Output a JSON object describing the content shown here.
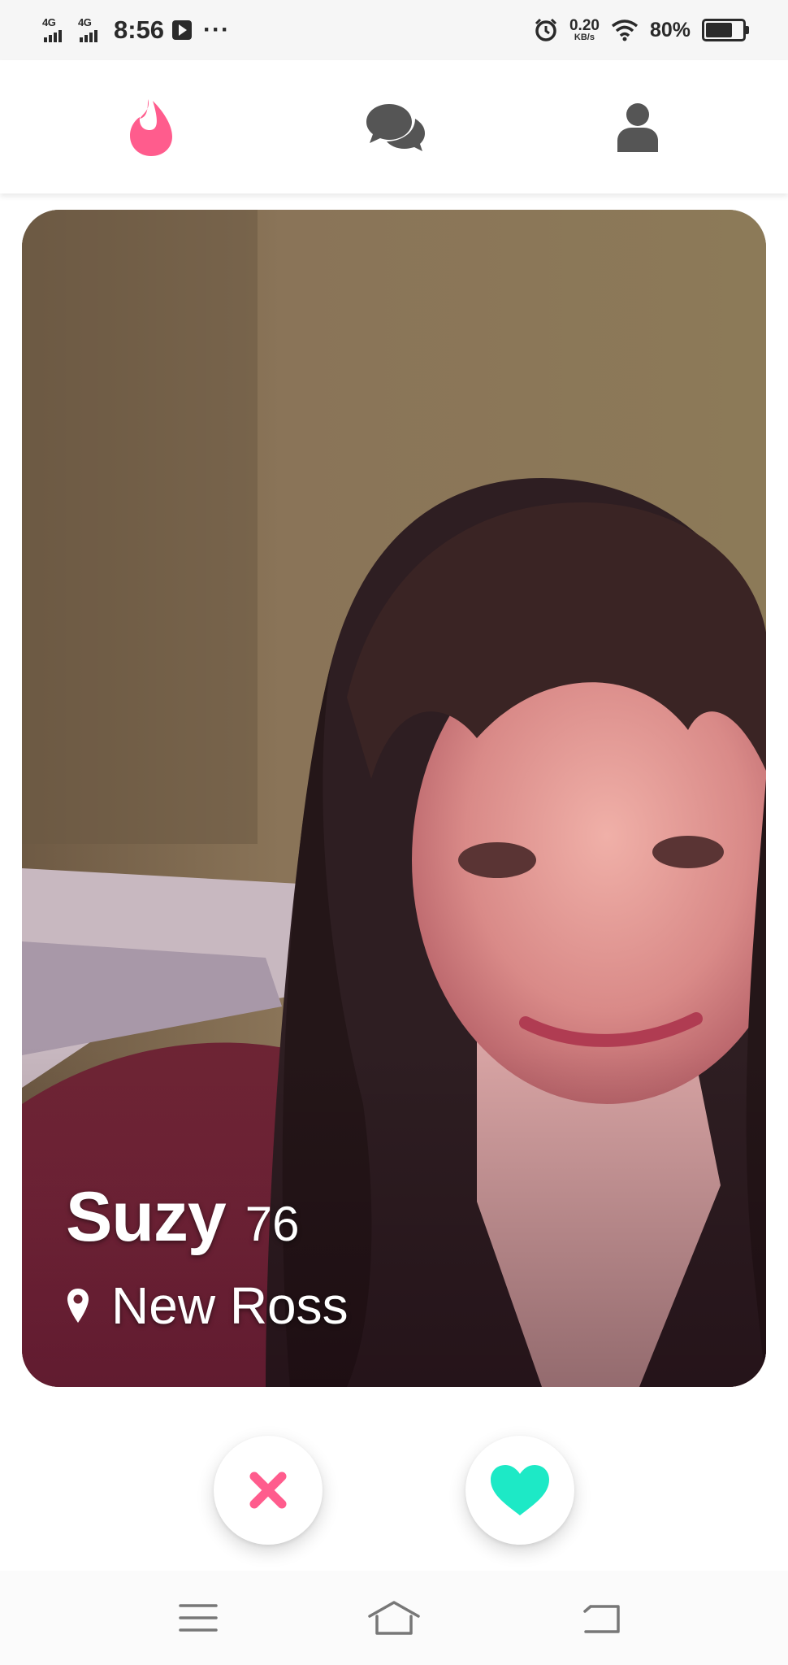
{
  "status_bar": {
    "network_1": "4G",
    "network_2": "4G",
    "time": "8:56",
    "more": "···",
    "speed_value": "0.20",
    "speed_unit": "KB/s",
    "battery_percent": "80%",
    "battery_level": 0.8
  },
  "top_nav": {
    "items": [
      {
        "icon": "flame-icon",
        "active": true
      },
      {
        "icon": "chat-bubbles-icon",
        "active": false
      },
      {
        "icon": "profile-icon",
        "active": false
      }
    ]
  },
  "card": {
    "name": "Suzy",
    "age": "76",
    "location": "New Ross",
    "location_icon": "map-pin-icon"
  },
  "actions": {
    "dislike_icon": "close-x-icon",
    "like_icon": "heart-icon"
  },
  "colors": {
    "brand_pink": "#ff5c8d",
    "like_teal": "#1de9c6",
    "nav_inactive": "#555555"
  },
  "system_nav": {
    "menu_icon": "menu-icon",
    "home_icon": "home-icon",
    "back_icon": "back-icon"
  }
}
